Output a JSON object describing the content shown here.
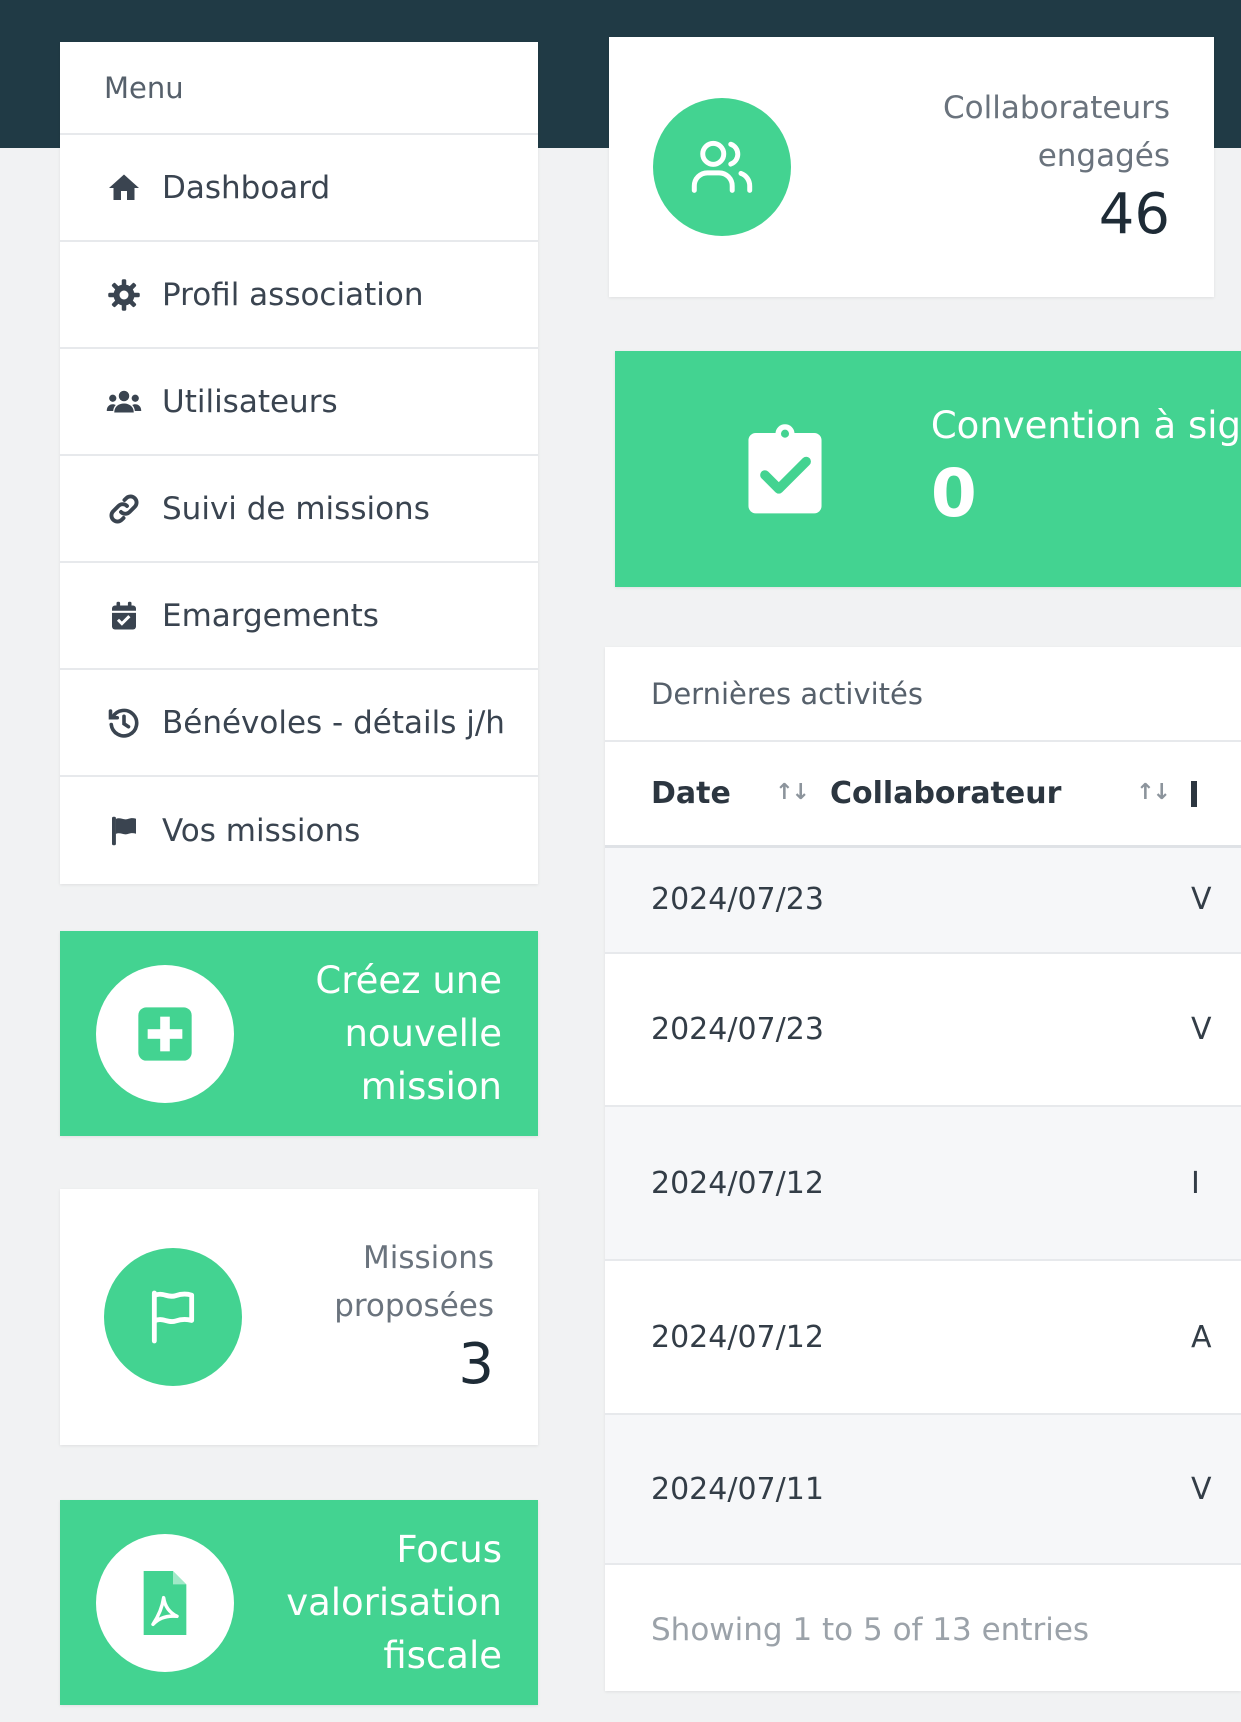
{
  "menu": {
    "title": "Menu",
    "items": [
      {
        "label": "Dashboard",
        "icon": "home-icon"
      },
      {
        "label": "Profil association",
        "icon": "gear-icon"
      },
      {
        "label": "Utilisateurs",
        "icon": "users-icon"
      },
      {
        "label": "Suivi de missions",
        "icon": "link-icon"
      },
      {
        "label": "Emargements",
        "icon": "calendar-check-icon"
      },
      {
        "label": "Bénévoles - détails j/h",
        "icon": "history-icon"
      },
      {
        "label": "Vos missions",
        "icon": "flag-icon"
      }
    ]
  },
  "create_mission": {
    "line1": "Créez une",
    "line2": "nouvelle",
    "line3": "mission",
    "icon": "plus-square-icon"
  },
  "missions_stat": {
    "line1": "Missions",
    "line2": "proposées",
    "value": "3",
    "icon": "flag-outline-icon"
  },
  "focus": {
    "line1": "Focus",
    "line2": "valorisation",
    "line3": "fiscale",
    "icon": "pdf-file-icon"
  },
  "collab_stat": {
    "line1": "Collaborateurs",
    "line2": "engagés",
    "value": "46",
    "icon": "users-outline-icon"
  },
  "convention": {
    "label": "Convention à sig",
    "value": "0",
    "icon": "clipboard-check-icon"
  },
  "activities": {
    "title": "Dernières activités",
    "columns": [
      "Date",
      "Collaborateur"
    ],
    "sort_glyph": "↑↓",
    "rows": [
      {
        "date": "2024/07/23",
        "collab": "",
        "desc": "V"
      },
      {
        "date": "2024/07/23",
        "collab": "",
        "desc": "V"
      },
      {
        "date": "2024/07/12",
        "collab": "",
        "desc": "I"
      },
      {
        "date": "2024/07/12",
        "collab": "",
        "desc": "A"
      },
      {
        "date": "2024/07/11",
        "collab": "",
        "desc": "V"
      }
    ],
    "footer": "Showing 1 to 5 of 13 entries"
  },
  "colors": {
    "accent": "#43d391",
    "topbar": "#203a45",
    "background": "#f1f2f3"
  }
}
